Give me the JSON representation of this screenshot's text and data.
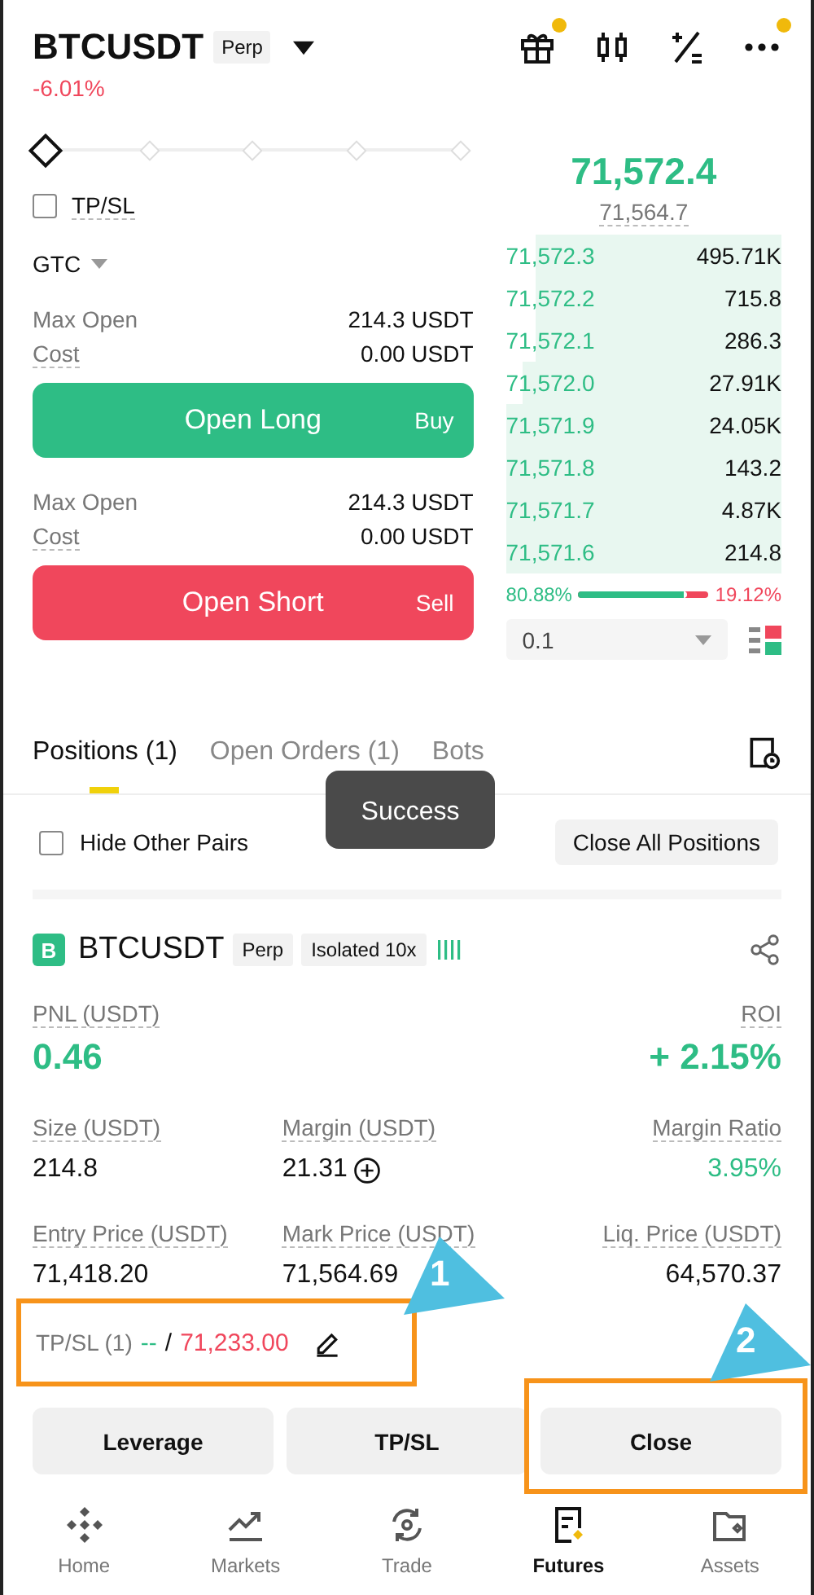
{
  "header": {
    "symbol": "BTCUSDT",
    "badge": "Perp",
    "change": "-6.01%",
    "icons": [
      {
        "kind": "gift",
        "dot": true
      },
      {
        "kind": "candles",
        "dot": false
      },
      {
        "kind": "calc",
        "dot": false
      },
      {
        "kind": "more",
        "dot": true
      }
    ]
  },
  "order_form": {
    "slider": {
      "level": 0
    },
    "tpsl": {
      "label": "TP/SL",
      "checked": false
    },
    "tif": "GTC",
    "sides": [
      {
        "kind": "long",
        "rows": [
          {
            "label": "Max Open",
            "value": "214.3 USDT"
          },
          {
            "label": "Cost",
            "value": "0.00 USDT"
          }
        ],
        "button": "Open Long",
        "side": "Buy"
      },
      {
        "kind": "short",
        "rows": [
          {
            "label": "Max Open",
            "value": "214.3 USDT"
          },
          {
            "label": "Cost",
            "value": "0.00 USDT"
          }
        ],
        "button": "Open Short",
        "side": "Sell"
      }
    ]
  },
  "order_book": {
    "last_price": "71,572.4",
    "mark_price": "71,564.7",
    "bids": [
      {
        "price": "71,572.3",
        "qty": "495.71K"
      },
      {
        "price": "71,572.2",
        "qty": "715.8"
      },
      {
        "price": "71,572.1",
        "qty": "286.3"
      },
      {
        "price": "71,572.0",
        "qty": "27.91K"
      },
      {
        "price": "71,571.9",
        "qty": "24.05K"
      },
      {
        "price": "71,571.8",
        "qty": "143.2"
      },
      {
        "price": "71,571.7",
        "qty": "4.87K"
      },
      {
        "price": "71,571.6",
        "qty": "214.8"
      }
    ],
    "buy_share": "80.88%",
    "sell_share": "19.12%",
    "ratio": {
      "level": 0.8088
    },
    "depth": "0.1"
  },
  "tabs": [
    {
      "label": "Positions (1)",
      "selected": true
    },
    {
      "label": "Open Orders (1)",
      "selected": false
    },
    {
      "label": "Bots",
      "selected": false
    }
  ],
  "toast": "Success",
  "filter": {
    "label": "Hide Other Pairs",
    "checked": false
  },
  "close_all": "Close All Positions",
  "position": {
    "coin": "B",
    "symbol": "BTCUSDT",
    "tags": [
      "Perp",
      "Isolated 10x"
    ],
    "rows": [
      {
        "kind": "headline",
        "cells": [
          {
            "label": "PNL (USDT)",
            "value": "0.46",
            "kind": "gain"
          },
          {
            "kind": "empty"
          },
          {
            "label": "ROI",
            "value": "+ 2.15%",
            "kind": "gain"
          }
        ]
      },
      {
        "kind": "triple",
        "cells": [
          {
            "label": "Size (USDT)",
            "value": "214.8",
            "kind": "plain"
          },
          {
            "label": "Margin (USDT)",
            "value": "21.31",
            "kind": "plain",
            "adjustable": true
          },
          {
            "label": "Margin Ratio",
            "value": "3.95%",
            "kind": "gain"
          }
        ]
      },
      {
        "kind": "triple",
        "cells": [
          {
            "label": "Entry Price (USDT)",
            "value": "71,418.20",
            "kind": "plain"
          },
          {
            "label": "Mark Price (USDT)",
            "value": "71,564.69",
            "kind": "plain"
          },
          {
            "label": "Liq. Price (USDT)",
            "value": "64,570.37",
            "kind": "plain"
          }
        ]
      }
    ],
    "tpsl": {
      "label": "TP/SL (1)",
      "tp": "--",
      "separator": "/",
      "sl": "71,233.00"
    },
    "buttons": [
      "Leverage",
      "TP/SL",
      "Close"
    ]
  },
  "nav": [
    {
      "kind": "home",
      "label": "Home",
      "selected": false
    },
    {
      "kind": "markets",
      "label": "Markets",
      "selected": false
    },
    {
      "kind": "trade",
      "label": "Trade",
      "selected": false
    },
    {
      "kind": "futures",
      "label": "Futures",
      "selected": true
    },
    {
      "kind": "assets",
      "label": "Assets",
      "selected": false
    }
  ],
  "annotations": [
    {
      "label": "1"
    },
    {
      "label": "2"
    }
  ]
}
